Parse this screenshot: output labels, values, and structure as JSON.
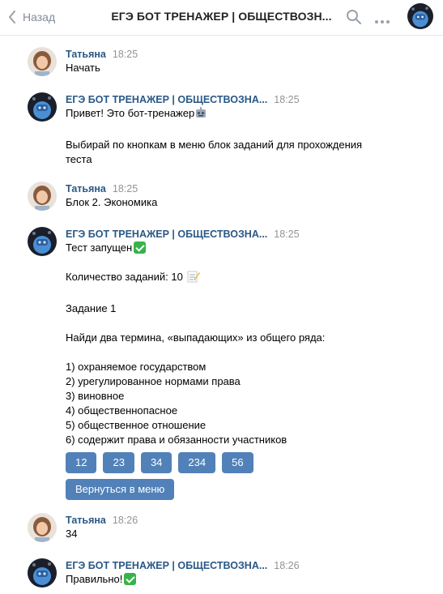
{
  "header": {
    "back_label": "Назад",
    "title": "ЕГЭ БОТ ТРЕНАЖЕР | ОБЩЕСТВОЗН..."
  },
  "colors": {
    "accent": "#5181b8",
    "author": "#2a5885",
    "time": "#939393"
  },
  "messages": [
    {
      "author": "Татьяна",
      "time": "18:25",
      "lines": [
        "Начать"
      ]
    },
    {
      "author": "ЕГЭ БОТ ТРЕНАЖЕР | ОБЩЕСТВОЗНА...",
      "time": "18:25",
      "line1": "Привет! Это бот-тренажер",
      "line2": "Выбирай по кнопкам в меню блок заданий для прохождения",
      "line3": "теста"
    },
    {
      "author": "Татьяна",
      "time": "18:25",
      "lines": [
        "Блок 2. Экономика"
      ]
    },
    {
      "author": "ЕГЭ БОТ ТРЕНАЖЕР | ОБЩЕСТВОЗНА...",
      "time": "18:25",
      "test_started": "Тест запущен",
      "task_count": "Количество заданий: 10",
      "task_title": "Задание 1",
      "question": "Найди два термина, «выпадающих» из общего ряда:",
      "options": [
        "1) охраняемое государством",
        "2) урегулированное нормами права",
        "3) виновное",
        "4) общественнопасное",
        "5) общественное отношение",
        "6) содержит права и обязанности участников"
      ],
      "answer_buttons": [
        "12",
        "23",
        "34",
        "234",
        "56"
      ],
      "menu_button": "Вернуться в меню"
    },
    {
      "author": "Татьяна",
      "time": "18:26",
      "lines": [
        "34"
      ]
    },
    {
      "author": "ЕГЭ БОТ ТРЕНАЖЕР | ОБЩЕСТВОЗНА...",
      "time": "18:26",
      "result": "Правильно!"
    }
  ]
}
